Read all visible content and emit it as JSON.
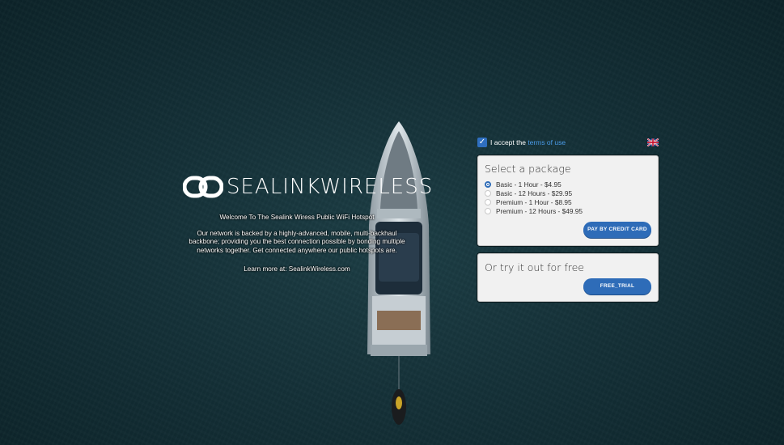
{
  "brand": {
    "logo_text": "SEALINKWIRELESS"
  },
  "promo": {
    "welcome": "Welcome To The Sealink Wiress Public WiFi Hotspot",
    "description": "Our network is backed by a highly-advanced, mobile, multi-backhaul backbone; providing you the best connection possible by bonding multiple networks together. Get connected anywhere our public hotspots are.",
    "learn_more": "Learn more at: SealinkWireless.com"
  },
  "terms": {
    "checked": true,
    "label": "I accept the ",
    "link": "terms of use"
  },
  "language_flag": "uk-flag-icon",
  "package_card": {
    "title": "Select a package",
    "packages": [
      {
        "label": "Basic - 1 Hour - $4.95",
        "selected": true
      },
      {
        "label": "Basic - 12 Hours - $29.95",
        "selected": false
      },
      {
        "label": "Premium - 1 Hour - $8.95",
        "selected": false
      },
      {
        "label": "Premium - 12 Hours - $49.95",
        "selected": false
      }
    ],
    "pay_button": "PAY BY CREDIT CARD"
  },
  "trial_card": {
    "title": "Or try it out for free",
    "trial_button": "FREE_TRIAL"
  },
  "colors": {
    "accent": "#2e6cb8",
    "link": "#4a9be8",
    "background": "#143138"
  }
}
